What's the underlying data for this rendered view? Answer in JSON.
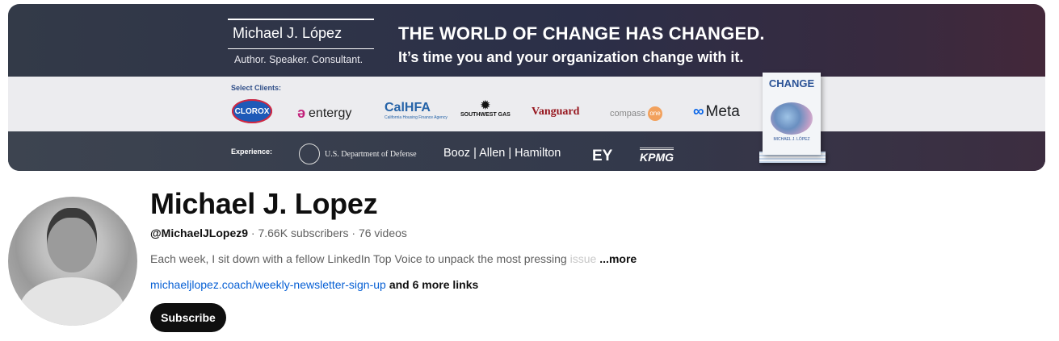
{
  "banner": {
    "name": "Michael J. López",
    "tagline": "Author. Speaker. Consultant.",
    "headline1": "THE WORLD OF CHANGE HAS CHANGED.",
    "headline2": "It’s time you and your organization change with it.",
    "clients_label": "Select Clients:",
    "clients": {
      "clorox": "CLOROX",
      "entergy": "entergy",
      "calhfa": "CalHFA",
      "calhfa_sub": "California Housing Finance Agency",
      "swgas": "SOUTHWEST GAS",
      "vanguard": "Vanguard",
      "compass": "compass",
      "compass_one": "one",
      "meta": "Meta"
    },
    "experience_label": "Experience:",
    "experience": {
      "dod": "U.S. Department of Defense",
      "booz": "Booz | Allen | Hamilton",
      "ey": "EY",
      "kpmg": "KPMG"
    },
    "book": {
      "title": "CHANGE",
      "author": "MICHAEL J. LÓPEZ"
    }
  },
  "channel": {
    "title": "Michael J. Lopez",
    "handle": "@MichaelJLopez9",
    "stats": " · 7.66K subscribers · 76 videos",
    "description": "Each week, I sit down with a fellow LinkedIn Top Voice to unpack the most pressing",
    "description_fade": " issue",
    "more_label": "...more",
    "link": "michaeljlopez.coach/weekly-newsletter-sign-up",
    "more_links": "and 6 more links",
    "subscribe_label": "Subscribe"
  }
}
